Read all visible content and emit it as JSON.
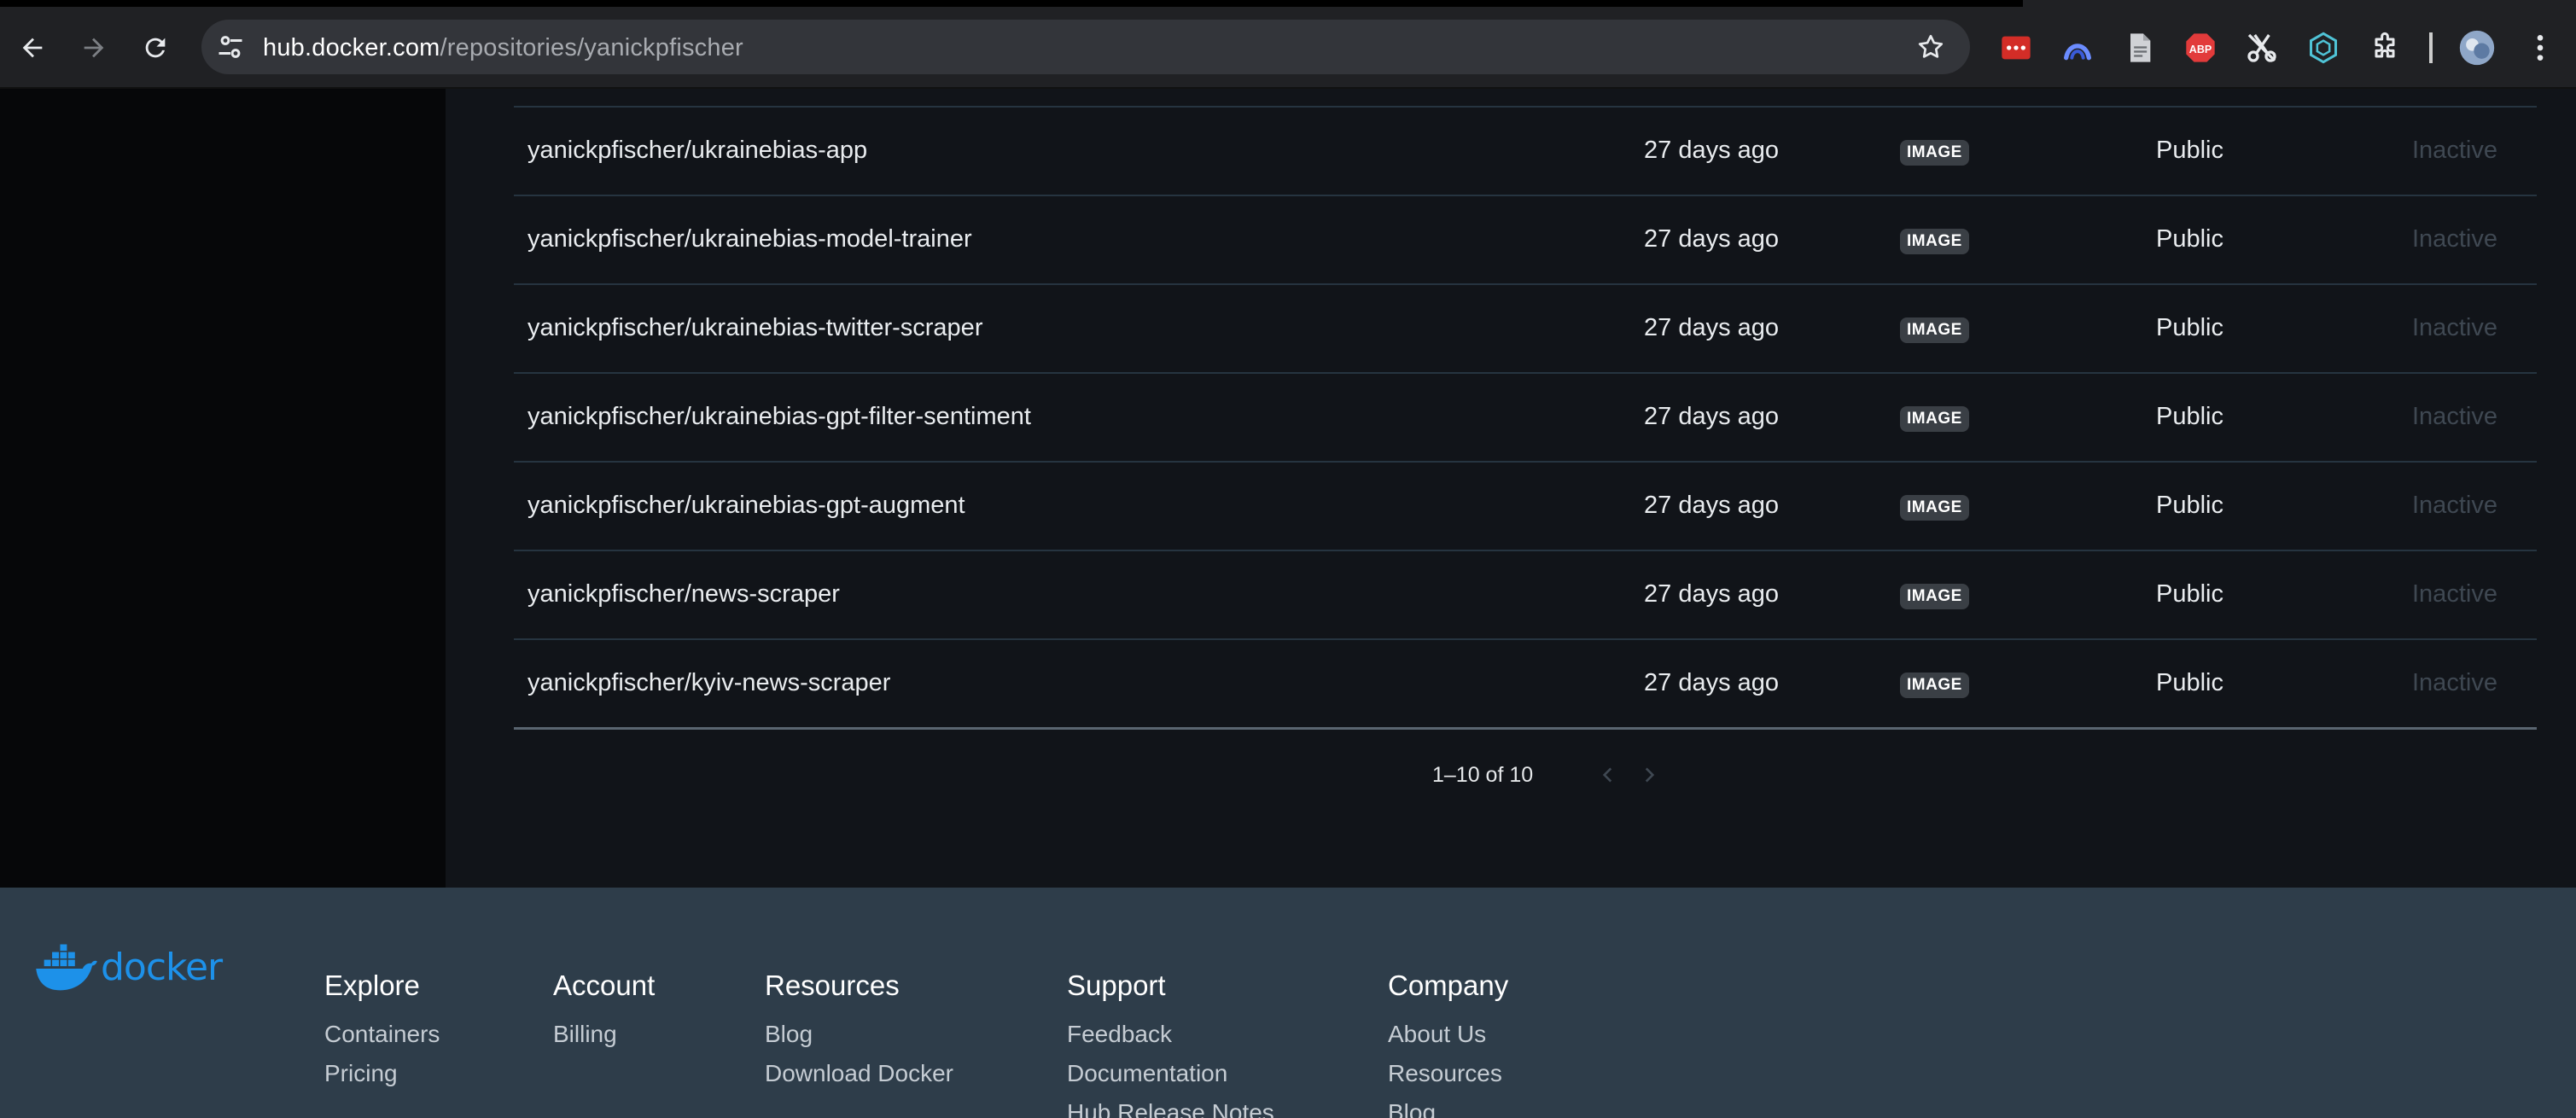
{
  "browser": {
    "url_host": "hub.docker.com",
    "url_path": "/repositories/yanickpfischer"
  },
  "repositories": [
    {
      "name": "yanickpfischer/ukrainebias-app",
      "updated": "27 days ago",
      "type": "IMAGE",
      "visibility": "Public",
      "status": "Inactive"
    },
    {
      "name": "yanickpfischer/ukrainebias-model-trainer",
      "updated": "27 days ago",
      "type": "IMAGE",
      "visibility": "Public",
      "status": "Inactive"
    },
    {
      "name": "yanickpfischer/ukrainebias-twitter-scraper",
      "updated": "27 days ago",
      "type": "IMAGE",
      "visibility": "Public",
      "status": "Inactive"
    },
    {
      "name": "yanickpfischer/ukrainebias-gpt-filter-sentiment",
      "updated": "27 days ago",
      "type": "IMAGE",
      "visibility": "Public",
      "status": "Inactive"
    },
    {
      "name": "yanickpfischer/ukrainebias-gpt-augment",
      "updated": "27 days ago",
      "type": "IMAGE",
      "visibility": "Public",
      "status": "Inactive"
    },
    {
      "name": "yanickpfischer/news-scraper",
      "updated": "27 days ago",
      "type": "IMAGE",
      "visibility": "Public",
      "status": "Inactive"
    },
    {
      "name": "yanickpfischer/kyiv-news-scraper",
      "updated": "27 days ago",
      "type": "IMAGE",
      "visibility": "Public",
      "status": "Inactive"
    }
  ],
  "pagination": {
    "label": "1–10 of 10"
  },
  "footer": {
    "logo_text": "docker",
    "columns": [
      {
        "heading": "Explore",
        "links": [
          "Containers",
          "Pricing"
        ]
      },
      {
        "heading": "Account",
        "links": [
          "Billing"
        ]
      },
      {
        "heading": "Resources",
        "links": [
          "Blog",
          "Download Docker"
        ]
      },
      {
        "heading": "Support",
        "links": [
          "Feedback",
          "Documentation",
          "Hub Release Notes"
        ]
      },
      {
        "heading": "Company",
        "links": [
          "About Us",
          "Resources",
          "Blog"
        ]
      }
    ]
  },
  "colors": {
    "page_bg": "#111419",
    "sidebar_bg": "#060709",
    "footer_bg": "#2e3d4a",
    "docker_blue": "#1d91e9",
    "inactive_text": "#3f4852"
  }
}
